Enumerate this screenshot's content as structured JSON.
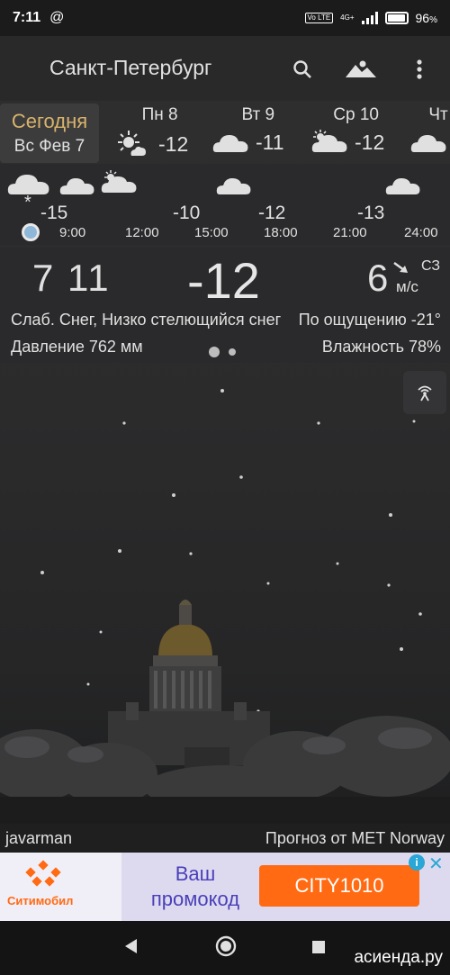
{
  "statusbar": {
    "time": "7:11",
    "at_icon": "@",
    "volte": "Vo LTE",
    "net": "4G+",
    "battery_pct": "96",
    "battery_suffix": "%",
    "battery_level": 0.96
  },
  "appbar": {
    "city": "Санкт-Петербург",
    "icons": [
      "search-icon",
      "landscape-icon",
      "more-vert-icon"
    ]
  },
  "days": {
    "today": {
      "label": "Сегодня",
      "date": "Вс Фев 7"
    },
    "list": [
      {
        "name": "Пн 8",
        "temp": "-12",
        "icon": "partly-sunny-icon"
      },
      {
        "name": "Вт 9",
        "temp": "-11",
        "icon": "cloud-icon"
      },
      {
        "name": "Ср 10",
        "temp": "-12",
        "icon": "partly-cloudy-icon"
      },
      {
        "name": "Чт",
        "temp": "",
        "icon": "cloud-icon"
      }
    ]
  },
  "hourly": {
    "temps": [
      "-15",
      "-10",
      "-12",
      "-13"
    ],
    "times": [
      "9:00",
      "12:00",
      "15:00",
      "18:00",
      "21:00",
      "24:00"
    ],
    "precip_symbol": "*"
  },
  "current": {
    "clock": "7 11",
    "temp": "-12",
    "wind_speed": "6",
    "wind_dir": "СЗ",
    "wind_unit": "м/с",
    "condition": "Слаб. Снег, Низко стелющийся снег",
    "feels": "По ощущению -21°",
    "pressure": "Давление 762 мм",
    "humidity": "Влажность 78%"
  },
  "footer": {
    "author": "javarman",
    "provider": "Прогноз от MET Norway"
  },
  "ad": {
    "brand": "Ситимобил",
    "promo": "Ваш промокод",
    "code": "CITY1010",
    "info_icon": "i",
    "close_icon": "✕"
  },
  "navbar": {
    "icons": [
      "back-icon",
      "home-icon",
      "recents-icon"
    ]
  },
  "watermark": "асиенда.ру",
  "colors": {
    "accent": "#d9b36c",
    "ad_orange": "#ff6a13",
    "ad_purple": "#4a3fb8",
    "now_dot": "#8fb8d8"
  }
}
